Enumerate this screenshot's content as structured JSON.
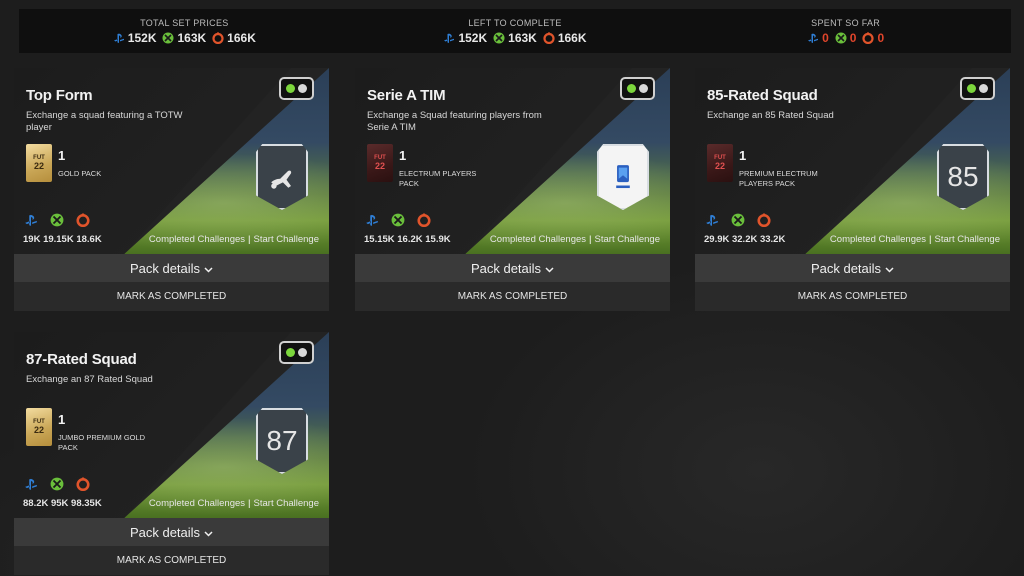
{
  "summary": {
    "total": {
      "title": "TOTAL SET PRICES",
      "ps": "152K",
      "xbox": "163K",
      "pc": "166K"
    },
    "left": {
      "title": "LEFT TO COMPLETE",
      "ps": "152K",
      "xbox": "163K",
      "pc": "166K"
    },
    "spent": {
      "title": "SPENT SO FAR",
      "ps": "0",
      "xbox": "0",
      "pc": "0"
    }
  },
  "common": {
    "completed_challenges": "Completed Challenges",
    "separator": "|",
    "start_challenge": "Start Challenge",
    "pack_details": "Pack details",
    "mark_completed": "MARK AS COMPLETED"
  },
  "cards": [
    {
      "title": "Top Form",
      "description": "Exchange a squad featuring a TOTW player",
      "pack_qty": "1",
      "pack_name": "GOLD PACK",
      "pack_style": "gold",
      "badge": "",
      "prices": "19K 19.15K 18.6K"
    },
    {
      "title": "Serie A TIM",
      "description": "Exchange a Squad featuring players from Serie A TIM",
      "pack_qty": "1",
      "pack_name": "ELECTRUM PLAYERS PACK",
      "pack_style": "electrum",
      "badge": "",
      "prices": "15.15K 16.2K 15.9K"
    },
    {
      "title": "85-Rated Squad",
      "description": "Exchange an 85 Rated Squad",
      "pack_qty": "1",
      "pack_name": "PREMIUM ELECTRUM PLAYERS PACK",
      "pack_style": "electrum",
      "badge": "85",
      "prices": "29.9K 32.2K 33.2K"
    },
    {
      "title": "87-Rated Squad",
      "description": "Exchange an 87 Rated Squad",
      "pack_qty": "1",
      "pack_name": "JUMBO PREMIUM GOLD PACK",
      "pack_style": "gold",
      "badge": "87",
      "prices": "88.2K 95K 98.35K"
    }
  ],
  "pack_logo": {
    "fut": "FUT",
    "year": "22"
  },
  "colors": {
    "ps": "#2f7fd6",
    "xbox": "#6abf3b",
    "pc": "#e0542b",
    "toggle_on": "#7cd63c"
  }
}
